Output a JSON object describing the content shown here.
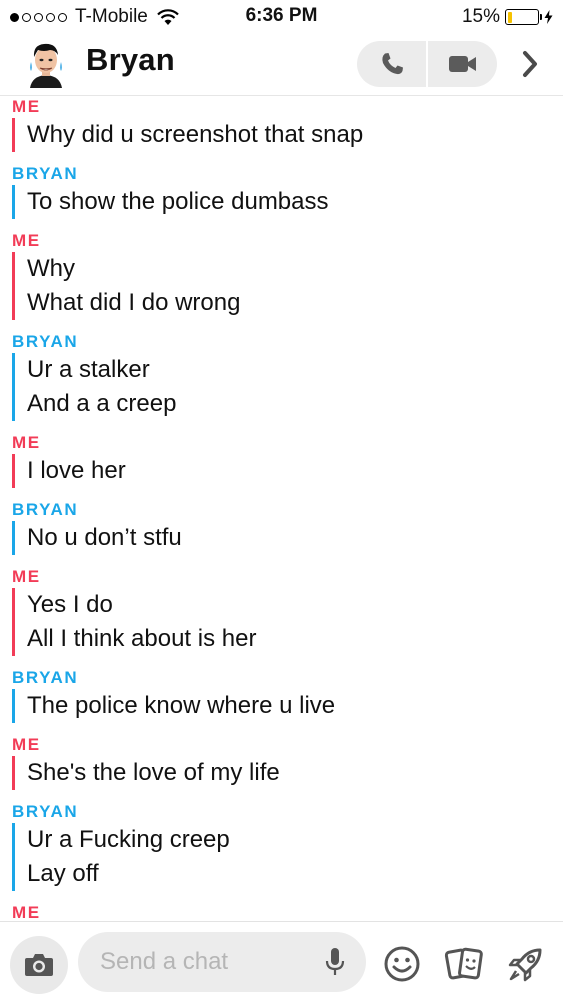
{
  "status_bar": {
    "carrier": "T-Mobile",
    "signal_bars_filled": 1,
    "signal_bars_total": 5,
    "time": "6:36 PM",
    "battery_percent": "15%",
    "battery_level": 0.15,
    "battery_color": "#f6c200"
  },
  "header": {
    "contact_name": "Bryan",
    "icons": [
      "avatar-icon",
      "phone-icon",
      "video-icon",
      "chevron-right-icon"
    ]
  },
  "colors": {
    "me": "#f23c57",
    "bryan": "#1aa6e8"
  },
  "conversation": [
    {
      "sender": "ME",
      "who": "me",
      "messages": [
        "Why did u screenshot that snap"
      ]
    },
    {
      "sender": "BRYAN",
      "who": "bryan",
      "messages": [
        "To show the police dumbass"
      ]
    },
    {
      "sender": "ME",
      "who": "me",
      "messages": [
        "Why",
        "What did I do wrong"
      ]
    },
    {
      "sender": "BRYAN",
      "who": "bryan",
      "messages": [
        "Ur a stalker",
        "And a a creep"
      ]
    },
    {
      "sender": "ME",
      "who": "me",
      "messages": [
        "I love her"
      ]
    },
    {
      "sender": "BRYAN",
      "who": "bryan",
      "messages": [
        "No u don’t stfu"
      ]
    },
    {
      "sender": "ME",
      "who": "me",
      "messages": [
        "Yes I do",
        "All I think about is her"
      ]
    },
    {
      "sender": "BRYAN",
      "who": "bryan",
      "messages": [
        "The police know where u live"
      ]
    },
    {
      "sender": "ME",
      "who": "me",
      "messages": [
        "She's the love of my life"
      ]
    },
    {
      "sender": "BRYAN",
      "who": "bryan",
      "messages": [
        "Ur a Fucking creep",
        "Lay off"
      ]
    },
    {
      "sender": "ME",
      "who": "me",
      "messages": []
    }
  ],
  "composer": {
    "placeholder": "Send a chat",
    "icons": [
      "camera-icon",
      "mic-icon",
      "smiley-icon",
      "stickers-icon",
      "rocket-icon"
    ]
  }
}
